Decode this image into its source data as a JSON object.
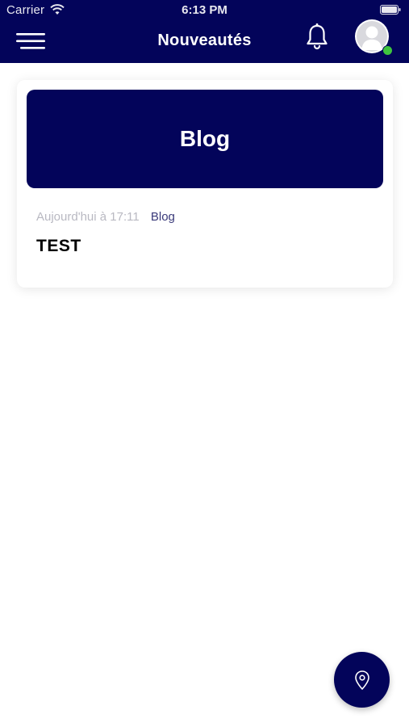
{
  "status_bar": {
    "carrier": "Carrier",
    "time": "6:13 PM"
  },
  "header": {
    "title": "Nouveautés",
    "menu_icon": "hamburger-menu-icon",
    "notification_icon": "bell-icon",
    "avatar_icon": "user-avatar-icon",
    "online_status_color": "#3ec43e"
  },
  "colors": {
    "primary": "#03045a",
    "muted_text": "#b9b9c2",
    "category_text": "#3a3a7a"
  },
  "feed": {
    "items": [
      {
        "banner_title": "Blog",
        "date": "Aujourd'hui à 17:11",
        "category": "Blog",
        "title": "TEST"
      }
    ]
  },
  "fab": {
    "icon": "map-pin-icon"
  }
}
